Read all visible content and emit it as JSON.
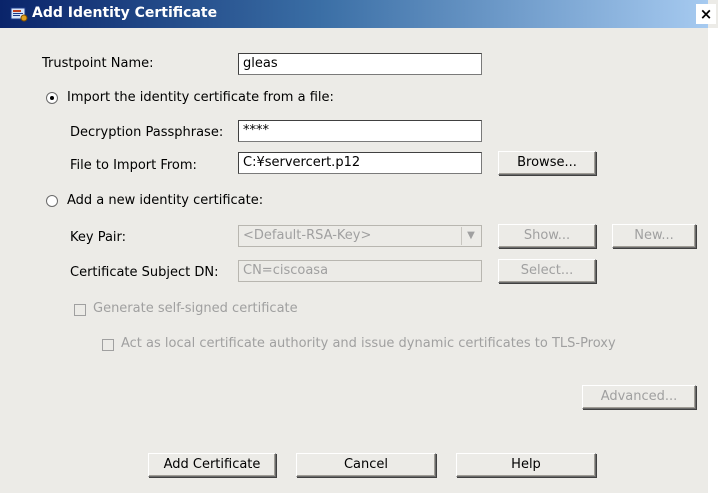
{
  "window": {
    "title": "Add Identity Certificate",
    "close_glyph": "×"
  },
  "form": {
    "trustpoint_label": "Trustpoint Name:",
    "trustpoint_value": "gleas",
    "import_radio_label": "Import the identity certificate from a file:",
    "passphrase_label": "Decryption Passphrase:",
    "passphrase_value": "****",
    "file_label": "File to Import From:",
    "file_value": "C:¥servercert.p12",
    "browse_label": "Browse...",
    "new_radio_label": "Add a new identity certificate:",
    "keypair_label": "Key Pair:",
    "keypair_value": "<Default-RSA-Key>",
    "show_label": "Show...",
    "new_label": "New...",
    "subject_label": "Certificate Subject DN:",
    "subject_value": "CN=ciscoasa",
    "select_label": "Select...",
    "selfsigned_label": "Generate self-signed certificate",
    "localca_label": "Act as local certificate authority and issue dynamic certificates to TLS-Proxy",
    "advanced_label": "Advanced..."
  },
  "footer": {
    "add_label": "Add Certificate",
    "cancel_label": "Cancel",
    "help_label": "Help"
  },
  "state": {
    "import_selected": true,
    "new_selected": false,
    "selfsigned_checked": false,
    "localca_checked": false
  },
  "colors": {
    "titlebar_start": "#0a246a",
    "titlebar_end": "#a6caf0",
    "dialog_bg": "#ecebe7",
    "disabled_text": "#a0a0a0"
  },
  "icons": {
    "title": "certificate-window-icon",
    "close": "close-icon",
    "dropdown": "chevron-down-icon"
  }
}
